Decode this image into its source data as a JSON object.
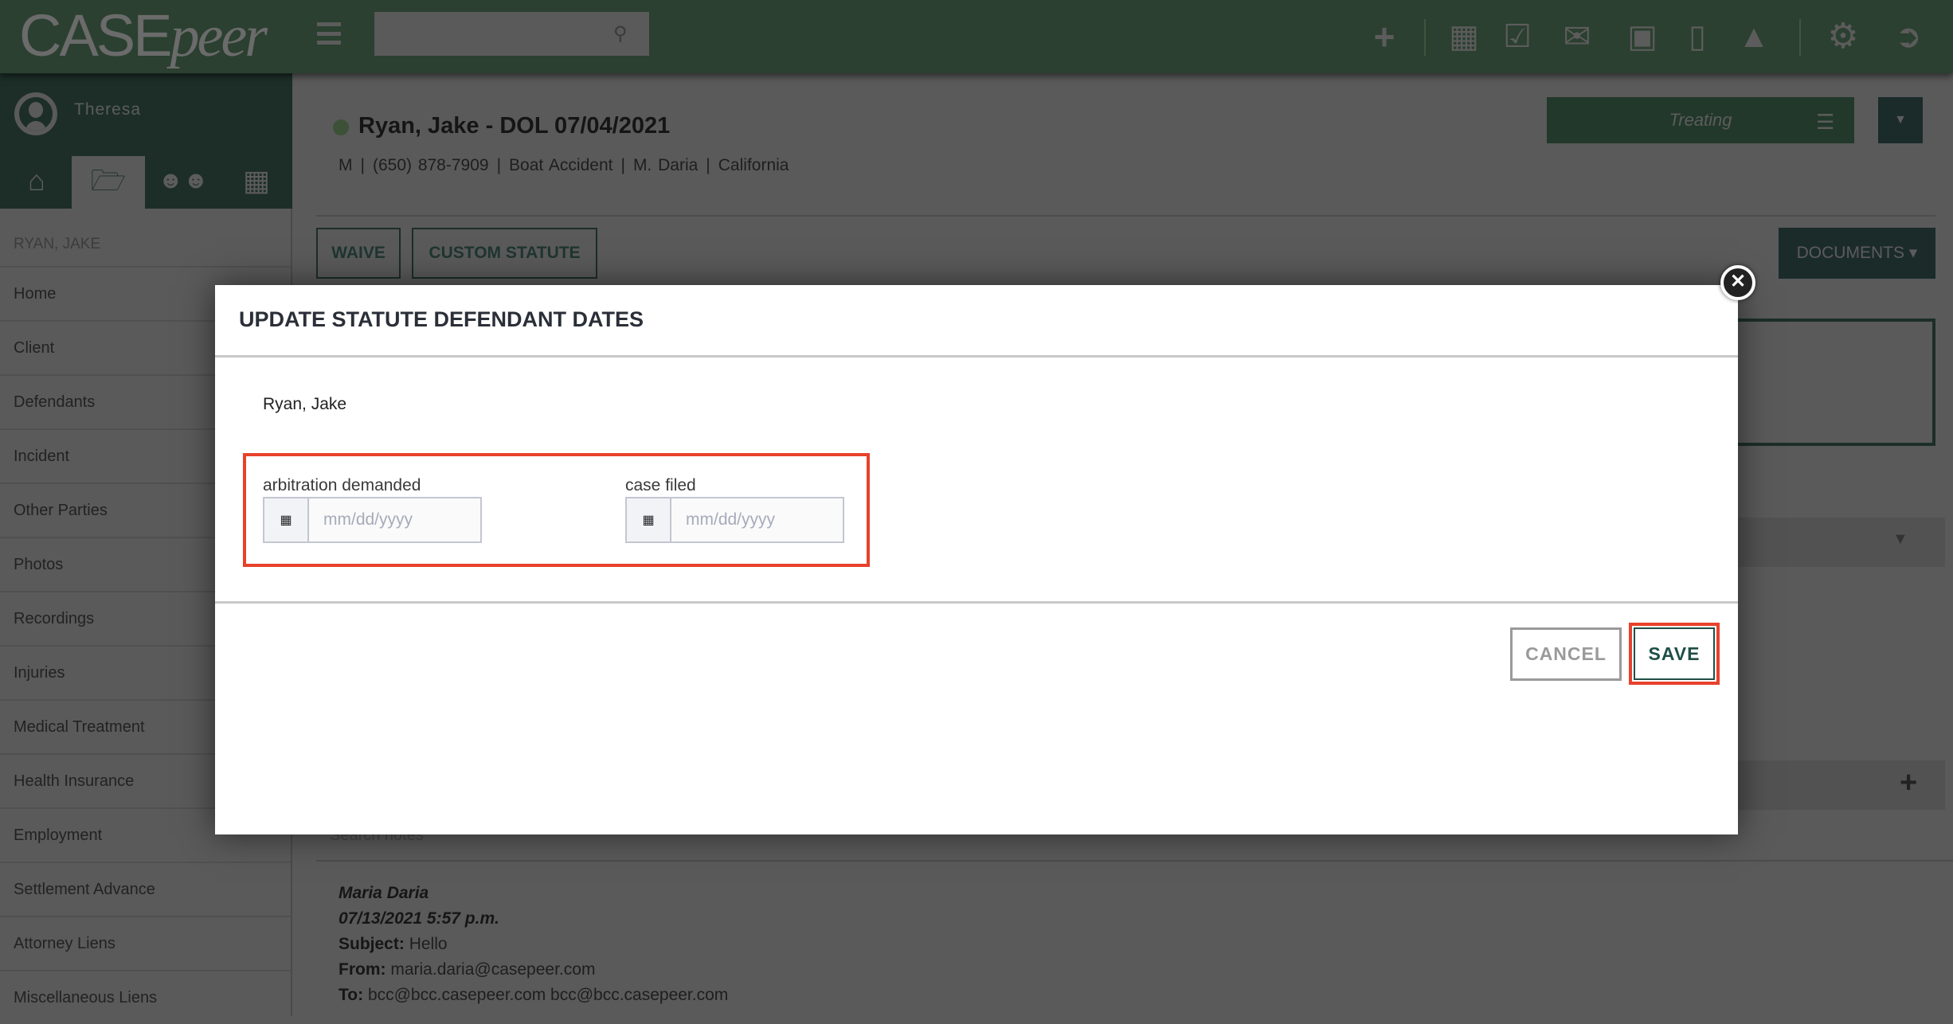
{
  "header": {
    "logo": "CASEpeer",
    "search": {
      "value": "",
      "placeholder": ""
    },
    "icons": [
      "plus-icon",
      "calendar-icon",
      "check-square-icon",
      "mail-icon",
      "inbox-icon",
      "phone-icon",
      "bell-icon",
      "gear-icon",
      "logout-icon"
    ]
  },
  "sidebar": {
    "user": "Theresa",
    "tabs": [
      "home-icon",
      "folder-open-icon",
      "users-icon",
      "calendar-icon"
    ],
    "active_tab": 1,
    "case_name": "RYAN, JAKE",
    "items": [
      "Home",
      "Client",
      "Defendants",
      "Incident",
      "Other Parties",
      "Photos",
      "Recordings",
      "Injuries",
      "Medical Treatment",
      "Health Insurance",
      "Employment",
      "Settlement Advance",
      "Attorney Liens",
      "Miscellaneous Liens"
    ]
  },
  "case": {
    "title": "Ryan, Jake - DOL 07/04/2021",
    "info": [
      "M",
      "(650) 878-7909",
      "Boat Accident",
      "M. Daria",
      "California"
    ],
    "status": "Treating",
    "waive": "WAIVE",
    "custom_statute": "CUSTOM STATUTE",
    "documents": "DOCUMENTS ▾"
  },
  "notes": {
    "search_placeholder": "Search notes",
    "author": "Maria Daria",
    "datetime": "07/13/2021 5:57 p.m.",
    "subject_label": "Subject:",
    "subject": "Hello",
    "from_label": "From:",
    "from": "maria.daria@casepeer.com",
    "to_label": "To:",
    "to": "bcc@bcc.casepeer.com bcc@bcc.casepeer.com"
  },
  "modal": {
    "title": "UPDATE STATUTE DEFENDANT DATES",
    "name": "Ryan, Jake",
    "fields": [
      {
        "label": "arbitration demanded",
        "value": "",
        "placeholder": "mm/dd/yyyy"
      },
      {
        "label": "case filed",
        "value": "",
        "placeholder": "mm/dd/yyyy"
      }
    ],
    "cancel": "CANCEL",
    "save": "SAVE"
  },
  "colors": {
    "header": "#2b4030",
    "highlight": "#e8412b",
    "save_text": "#1f4f47"
  }
}
